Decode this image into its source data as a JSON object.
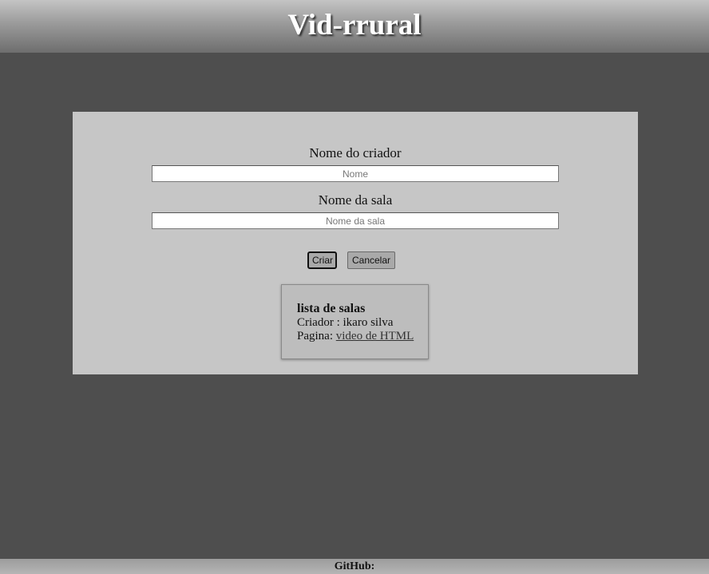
{
  "header": {
    "title": "Vid-rrural"
  },
  "form": {
    "creator_label": "Nome do criador",
    "creator_placeholder": "Nome",
    "creator_value": "",
    "room_label": "Nome da sala",
    "room_placeholder": "Nome da sala",
    "room_value": "",
    "create_button": "Criar",
    "cancel_button": "Cancelar"
  },
  "rooms": {
    "title": "lista de salas",
    "items": [
      {
        "creator_prefix": "Criador : ",
        "creator_name": "ikaro silva",
        "page_prefix": "Pagina: ",
        "page_link": "video de HTML"
      }
    ]
  },
  "footer": {
    "text": "GitHub:"
  }
}
